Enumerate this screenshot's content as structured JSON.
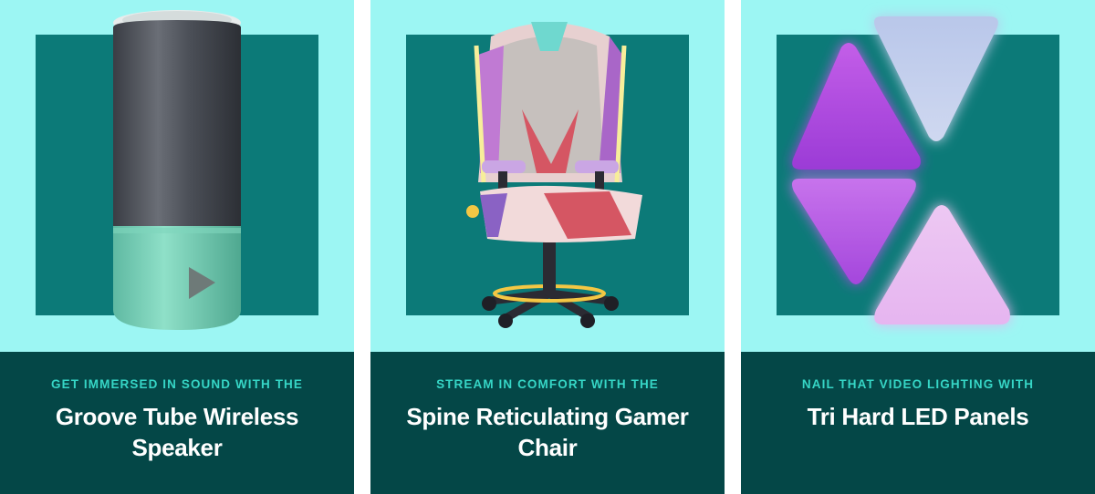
{
  "cards": [
    {
      "eyebrow": "GET IMMERSED IN SOUND WITH THE",
      "title": "Groove Tube Wireless Speaker",
      "image": "speaker-illustration"
    },
    {
      "eyebrow": "STREAM IN COMFORT WITH THE",
      "title": "Spine Reticulating Gamer Chair",
      "image": "gamer-chair-illustration"
    },
    {
      "eyebrow": "NAIL THAT VIDEO LIGHTING WITH",
      "title": "Tri Hard LED Panels",
      "image": "led-panels-illustration"
    }
  ],
  "colors": {
    "image_bg": "#9cf6f3",
    "square": "#0c7a78",
    "caption_bg": "#044747",
    "eyebrow": "#36d6c6",
    "title": "#ffffff"
  }
}
